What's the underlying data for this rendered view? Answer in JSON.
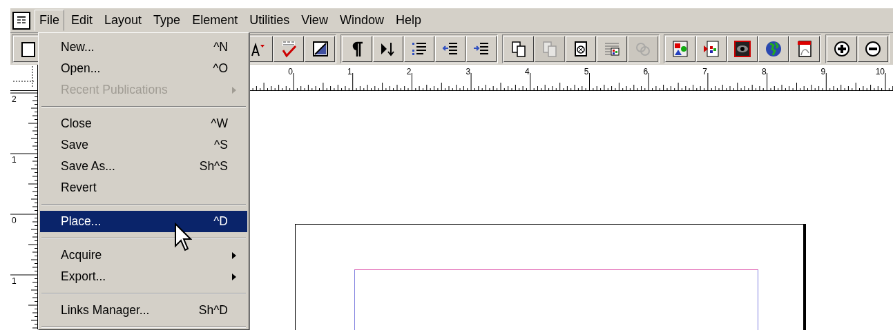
{
  "menu_bar": {
    "items": [
      {
        "label": "File",
        "selected": true
      },
      {
        "label": "Edit",
        "selected": false
      },
      {
        "label": "Layout",
        "selected": false
      },
      {
        "label": "Type",
        "selected": false
      },
      {
        "label": "Element",
        "selected": false
      },
      {
        "label": "Utilities",
        "selected": false
      },
      {
        "label": "View",
        "selected": false
      },
      {
        "label": "Window",
        "selected": false
      },
      {
        "label": "Help",
        "selected": false
      }
    ]
  },
  "toolbar": {
    "groups": [
      [
        {
          "kind": "rectangle",
          "disabled": false
        }
      ],
      [
        {
          "kind": "font-size",
          "disabled": false
        },
        {
          "kind": "spelling",
          "disabled": false
        },
        {
          "kind": "fill",
          "disabled": false
        }
      ],
      [
        {
          "kind": "paragraph",
          "disabled": false
        },
        {
          "kind": "flow",
          "disabled": false
        },
        {
          "kind": "bullets",
          "disabled": false
        },
        {
          "kind": "outdent",
          "disabled": false
        },
        {
          "kind": "indent",
          "disabled": false
        }
      ],
      [
        {
          "kind": "copy",
          "disabled": false
        },
        {
          "kind": "paste",
          "disabled": true
        },
        {
          "kind": "frame",
          "disabled": false
        },
        {
          "kind": "text-image",
          "disabled": false
        },
        {
          "kind": "links",
          "disabled": true
        }
      ],
      [
        {
          "kind": "image",
          "disabled": false
        },
        {
          "kind": "import",
          "disabled": false
        },
        {
          "kind": "eye",
          "disabled": false
        },
        {
          "kind": "globe",
          "disabled": false
        },
        {
          "kind": "pdf",
          "disabled": false
        }
      ],
      [
        {
          "kind": "zoom-in",
          "disabled": false
        },
        {
          "kind": "zoom-out",
          "disabled": false
        }
      ]
    ]
  },
  "horizontal_ruler": {
    "labels": [
      "0",
      "1",
      "2",
      "3",
      "4",
      "5",
      "6",
      "7",
      "8",
      "9",
      "10"
    ]
  },
  "vertical_ruler": {
    "labels": [
      "2",
      "1",
      "0",
      "1"
    ]
  },
  "file_menu": {
    "items": [
      {
        "kind": "item",
        "label": "New...",
        "shortcut": "^N",
        "disabled": false,
        "submenu": false,
        "selected": false
      },
      {
        "kind": "item",
        "label": "Open...",
        "shortcut": "^O",
        "disabled": false,
        "submenu": false,
        "selected": false
      },
      {
        "kind": "item",
        "label": "Recent Publications",
        "disabled": true,
        "submenu": true,
        "selected": false
      },
      {
        "kind": "separator"
      },
      {
        "kind": "item",
        "label": "Close",
        "shortcut": "^W",
        "disabled": false,
        "submenu": false,
        "selected": false
      },
      {
        "kind": "item",
        "label": "Save",
        "shortcut": "^S",
        "disabled": false,
        "submenu": false,
        "selected": false
      },
      {
        "kind": "item",
        "label": "Save As...",
        "shortcut": "Sh^S",
        "disabled": false,
        "submenu": false,
        "selected": false
      },
      {
        "kind": "item",
        "label": "Revert",
        "disabled": false,
        "submenu": false,
        "selected": false
      },
      {
        "kind": "separator"
      },
      {
        "kind": "item",
        "label": "Place...",
        "shortcut": "^D",
        "disabled": false,
        "submenu": false,
        "selected": true
      },
      {
        "kind": "separator"
      },
      {
        "kind": "item",
        "label": "Acquire",
        "disabled": false,
        "submenu": true,
        "selected": false
      },
      {
        "kind": "item",
        "label": "Export...",
        "disabled": false,
        "submenu": true,
        "selected": false
      },
      {
        "kind": "separator"
      },
      {
        "kind": "item",
        "label": "Links Manager...",
        "shortcut": "Sh^D",
        "disabled": false,
        "submenu": false,
        "selected": false
      },
      {
        "kind": "separator"
      }
    ]
  }
}
